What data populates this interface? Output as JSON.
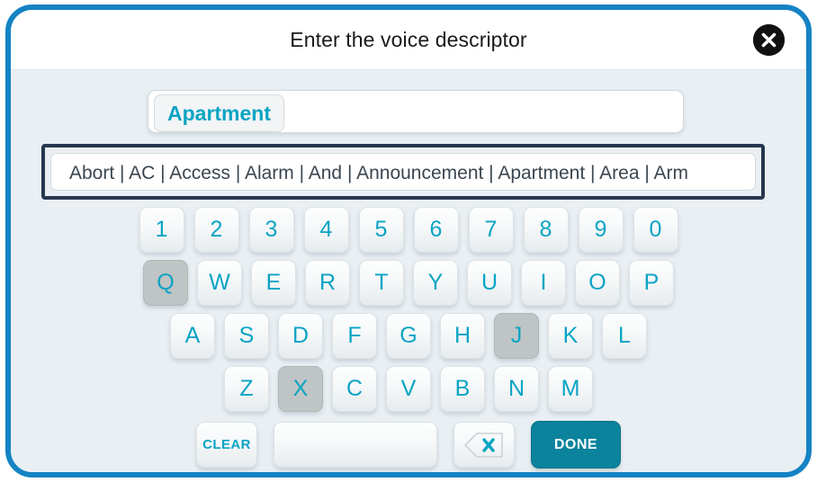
{
  "dialog": {
    "title": "Enter the voice descriptor",
    "close_icon": "close-circle-icon",
    "frame_color": "#1583c4",
    "background_color": "#e9eff3"
  },
  "entry": {
    "value": "Apartment",
    "placeholder": "",
    "text_color": "#0aa4c4"
  },
  "suggestions": {
    "text": "Abort | AC | Access | Alarm | And | Announcement | Apartment | Area | Arm",
    "items": [
      "Abort",
      "AC",
      "Access",
      "Alarm",
      "And",
      "Announcement",
      "Apartment",
      "Area",
      "Arm"
    ],
    "separator": "|",
    "outline_color": "#26374f"
  },
  "keyboard": {
    "rows": [
      {
        "id": "numbers",
        "keys": [
          {
            "label": "1",
            "state": "normal"
          },
          {
            "label": "2",
            "state": "normal"
          },
          {
            "label": "3",
            "state": "normal"
          },
          {
            "label": "4",
            "state": "normal"
          },
          {
            "label": "5",
            "state": "normal"
          },
          {
            "label": "6",
            "state": "normal"
          },
          {
            "label": "7",
            "state": "normal"
          },
          {
            "label": "8",
            "state": "normal"
          },
          {
            "label": "9",
            "state": "normal"
          },
          {
            "label": "0",
            "state": "normal"
          }
        ]
      },
      {
        "id": "qwerty",
        "keys": [
          {
            "label": "Q",
            "state": "pressed"
          },
          {
            "label": "W",
            "state": "normal"
          },
          {
            "label": "E",
            "state": "normal"
          },
          {
            "label": "R",
            "state": "normal"
          },
          {
            "label": "T",
            "state": "normal"
          },
          {
            "label": "Y",
            "state": "normal"
          },
          {
            "label": "U",
            "state": "normal"
          },
          {
            "label": "I",
            "state": "normal"
          },
          {
            "label": "O",
            "state": "normal"
          },
          {
            "label": "P",
            "state": "normal"
          }
        ]
      },
      {
        "id": "asdf",
        "keys": [
          {
            "label": "A",
            "state": "normal"
          },
          {
            "label": "S",
            "state": "normal"
          },
          {
            "label": "D",
            "state": "normal"
          },
          {
            "label": "F",
            "state": "normal"
          },
          {
            "label": "G",
            "state": "normal"
          },
          {
            "label": "H",
            "state": "normal"
          },
          {
            "label": "J",
            "state": "pressed"
          },
          {
            "label": "K",
            "state": "normal"
          },
          {
            "label": "L",
            "state": "normal"
          }
        ]
      },
      {
        "id": "zxcv",
        "keys": [
          {
            "label": "Z",
            "state": "normal"
          },
          {
            "label": "X",
            "state": "pressed"
          },
          {
            "label": "C",
            "state": "normal"
          },
          {
            "label": "V",
            "state": "normal"
          },
          {
            "label": "B",
            "state": "normal"
          },
          {
            "label": "N",
            "state": "normal"
          },
          {
            "label": "M",
            "state": "normal"
          }
        ]
      }
    ],
    "clear_label": "CLEAR",
    "space_label": "",
    "backspace_icon": "backspace-icon",
    "done_label": "DONE",
    "key_text_color": "#0aa4c4",
    "done_color": "#0b839d",
    "pressed_key_color": "#bfc4c5"
  }
}
